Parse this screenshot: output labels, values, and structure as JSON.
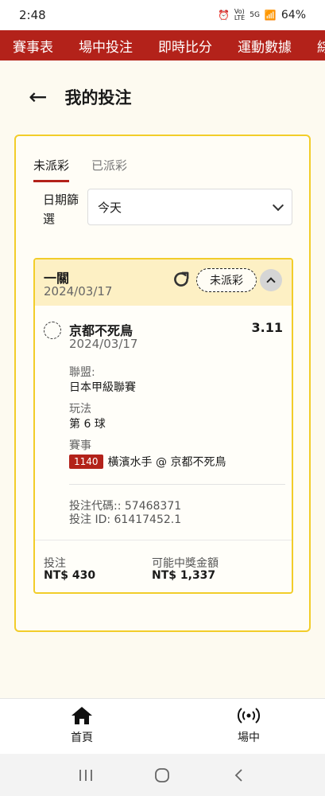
{
  "status_bar": {
    "time": "2:48",
    "battery": "64%",
    "network": "5G"
  },
  "top_nav": {
    "items": [
      "賽事表",
      "場中投注",
      "即時比分",
      "運動數據",
      "綜"
    ]
  },
  "header": {
    "title": "我的投注"
  },
  "tabs": [
    {
      "label": "未派彩",
      "active": true
    },
    {
      "label": "已派彩",
      "active": false
    }
  ],
  "date_filter": {
    "label": "日期篩選",
    "value": "今天"
  },
  "bet": {
    "type": "一關",
    "date": "2024/03/17",
    "status": "未派彩",
    "selection": {
      "name": "京都不死鳥",
      "odds": "3.11",
      "date": "2024/03/17",
      "league_label": "聯盟:",
      "league": "日本甲級聯賽",
      "play_label": "玩法",
      "play": "第 6 球",
      "event_label": "賽事",
      "match_no": "1140",
      "match": "橫濱水手 @ 京都不死鳥"
    },
    "code": "投注代碼:: 57468371",
    "bet_id": "投注 ID: 61417452.1",
    "stake_label": "投注",
    "stake": "NT$ 430",
    "payout_label": "可能中獎金額",
    "payout": "NT$ 1,337"
  },
  "bottom_nav": [
    {
      "label": "首頁",
      "icon": "home-icon"
    },
    {
      "label": "場中",
      "icon": "live-broadcast-icon"
    }
  ],
  "colors": {
    "brand_red": "#b3221a",
    "accent_yellow": "#f2cd2a",
    "header_bg": "#fdf0c4"
  }
}
